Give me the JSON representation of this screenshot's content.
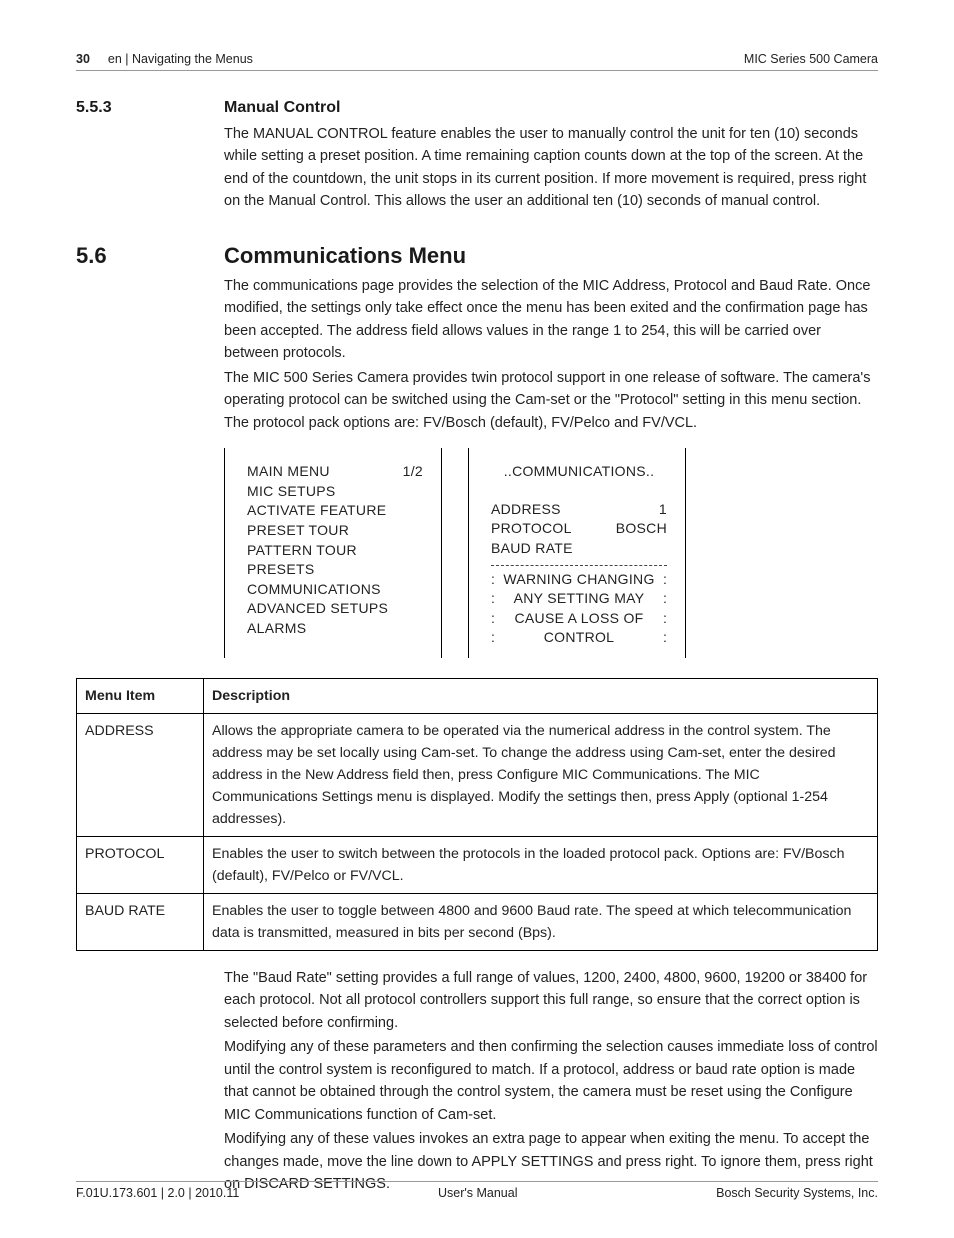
{
  "header": {
    "page_number": "30",
    "breadcrumb": "en | Navigating the Menus",
    "product": "MIC Series 500 Camera"
  },
  "section_553": {
    "num": "5.5.3",
    "title": "Manual Control",
    "para": "The MANUAL CONTROL feature enables the user to manually control the unit for ten (10) seconds while setting a preset position. A time remaining caption counts down at the top of the screen. At the end of the countdown, the unit stops in its current position. If more movement is required, press right on the Manual Control. This allows the user an additional ten (10) seconds of manual control."
  },
  "section_56": {
    "num": "5.6",
    "title": "Communications Menu",
    "para1": "The communications page provides the selection of the MIC Address, Protocol and Baud Rate. Once modified, the settings only take effect once the menu has been exited and the confirmation page has been accepted. The address field allows values in the range 1 to 254, this will be carried over between protocols.",
    "para2": "The MIC 500 Series Camera provides twin protocol support in one release of software. The camera's operating protocol can be switched using the Cam-set or the \"Protocol\" setting in this menu section. The protocol pack options are: FV/Bosch (default), FV/Pelco and FV/VCL."
  },
  "menu_left": {
    "title": "MAIN MENU",
    "page": "1/2",
    "items": [
      "MIC SETUPS",
      "ACTIVATE FEATURE",
      "PRESET TOUR",
      "PATTERN TOUR",
      "PRESETS",
      "COMMUNICATIONS",
      "ADVANCED SETUPS",
      "ALARMS"
    ]
  },
  "menu_right": {
    "title": "..COMMUNICATIONS..",
    "rows": [
      {
        "k": "ADDRESS",
        "v": "1"
      },
      {
        "k": "PROTOCOL",
        "v": "BOSCH"
      },
      {
        "k": "BAUD RATE",
        "v": ""
      }
    ],
    "warning": [
      "WARNING CHANGING",
      "ANY SETTING MAY",
      "CAUSE A LOSS OF",
      "CONTROL"
    ]
  },
  "table": {
    "headers": [
      "Menu Item",
      "Description"
    ],
    "rows": [
      {
        "item": "ADDRESS",
        "desc": "Allows the appropriate camera to be operated via the numerical address in the control system. The address may be set locally using Cam-set. To change the address using Cam-set, enter the desired address in the New Address field then, press Configure MIC Communications. The MIC Communications Settings menu is displayed. Modify the settings then, press Apply (optional 1-254 addresses)."
      },
      {
        "item": "PROTOCOL",
        "desc": "Enables the user to switch between the protocols in the loaded protocol pack. Options are: FV/Bosch (default), FV/Pelco or FV/VCL."
      },
      {
        "item": "BAUD RATE",
        "desc": "Enables the user to toggle between 4800 and 9600 Baud rate. The speed at which telecommunication data is transmitted, measured in bits per second (Bps)."
      }
    ]
  },
  "after_table": {
    "p1": "The \"Baud Rate\" setting provides a full range of values, 1200, 2400, 4800, 9600, 19200 or 38400 for each protocol. Not all protocol controllers support this full range, so ensure that the correct option is selected before confirming.",
    "p2": "Modifying any of these parameters and then confirming the selection causes immediate loss of control until the control system is reconfigured to match. If a protocol, address or baud rate option is made that cannot be obtained through the control system, the camera must be reset using the Configure MIC Communications function of Cam-set.",
    "p3": "Modifying any of these values invokes an extra page to appear when exiting the menu. To accept the changes made, move the line down to APPLY SETTINGS and press right. To ignore them, press right on DISCARD SETTINGS."
  },
  "footer": {
    "left": "F.01U.173.601 | 2.0 | 2010.11",
    "center": "User's Manual",
    "right": "Bosch Security Systems, Inc."
  }
}
